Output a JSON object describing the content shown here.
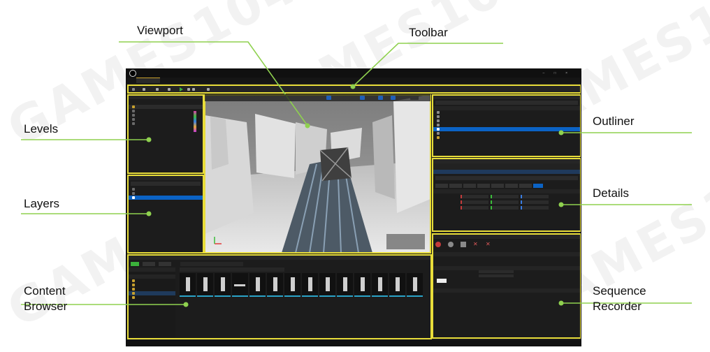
{
  "callouts": {
    "viewport": "Viewport",
    "toolbar": "Toolbar",
    "levels": "Levels",
    "outliner": "Outliner",
    "layers": "Layers",
    "details": "Details",
    "content_browser_line1": "Content",
    "content_browser_line2": "Browser",
    "sequence_recorder_line1": "Sequence",
    "sequence_recorder_line2": "Recorder"
  },
  "colors": {
    "highlight": "#e8dd3a",
    "leader": "#8fd14f",
    "editor_bg": "#1a1a1a",
    "selection": "#0b63c5"
  }
}
